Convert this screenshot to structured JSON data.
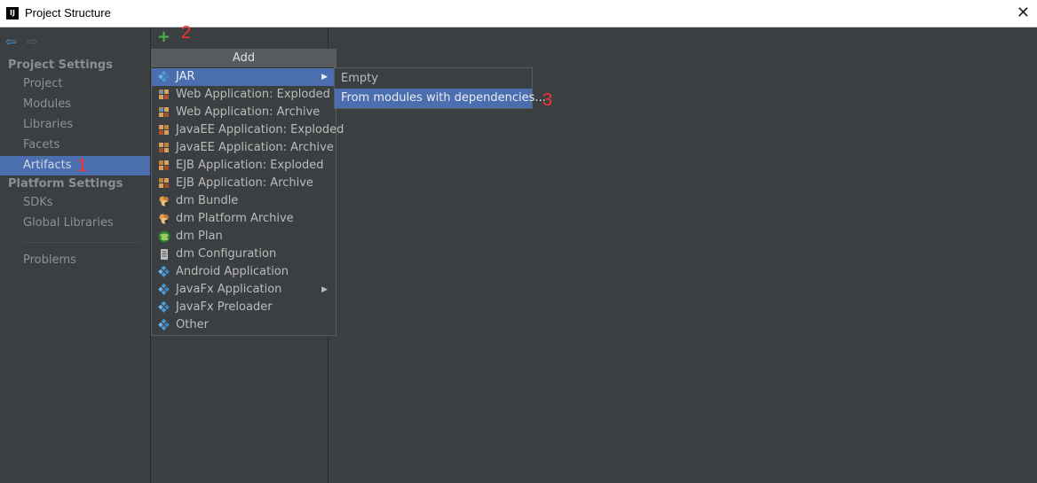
{
  "window": {
    "title": "Project Structure",
    "app_icon": "IJ"
  },
  "nav": {
    "back_icon": "arrow-left-icon",
    "forward_icon": "arrow-right-icon"
  },
  "sidebar": {
    "project_settings": "Project Settings",
    "project_items": [
      "Project",
      "Modules",
      "Libraries",
      "Facets",
      "Artifacts"
    ],
    "platform_settings": "Platform Settings",
    "platform_items": [
      "SDKs",
      "Global Libraries"
    ],
    "problems": "Problems",
    "selected": "Artifacts"
  },
  "toolbar": {
    "add_glyph": "+"
  },
  "annotations": [
    "1",
    "2",
    "3"
  ],
  "add_menu": {
    "header": "Add",
    "items": [
      {
        "label": "JAR",
        "icon": "diamond-icon",
        "submenu": true
      },
      {
        "label": "Web Application: Exploded",
        "icon": "web-app-icon"
      },
      {
        "label": "Web Application: Archive",
        "icon": "web-app-icon"
      },
      {
        "label": "JavaEE Application: Exploded",
        "icon": "javaee-icon"
      },
      {
        "label": "JavaEE Application: Archive",
        "icon": "javaee-icon"
      },
      {
        "label": "EJB Application: Exploded",
        "icon": "ejb-icon"
      },
      {
        "label": "EJB Application: Archive",
        "icon": "ejb-icon"
      },
      {
        "label": "dm Bundle",
        "icon": "bundle-icon"
      },
      {
        "label": "dm Platform Archive",
        "icon": "bundle-icon"
      },
      {
        "label": "dm Plan",
        "icon": "globe-icon"
      },
      {
        "label": "dm Configuration",
        "icon": "document-icon"
      },
      {
        "label": "Android Application",
        "icon": "diamond-icon"
      },
      {
        "label": "JavaFx Application",
        "icon": "diamond-icon",
        "submenu": true
      },
      {
        "label": "JavaFx Preloader",
        "icon": "diamond-icon"
      },
      {
        "label": "Other",
        "icon": "diamond-icon"
      }
    ]
  },
  "jar_submenu": {
    "items": [
      "Empty",
      "From modules with dependencies..."
    ],
    "highlighted": 1
  },
  "colors": {
    "selection": "#4b6eaf",
    "background": "#3c3f41",
    "annotation": "#ff3030",
    "add_button": "#4caf50"
  }
}
